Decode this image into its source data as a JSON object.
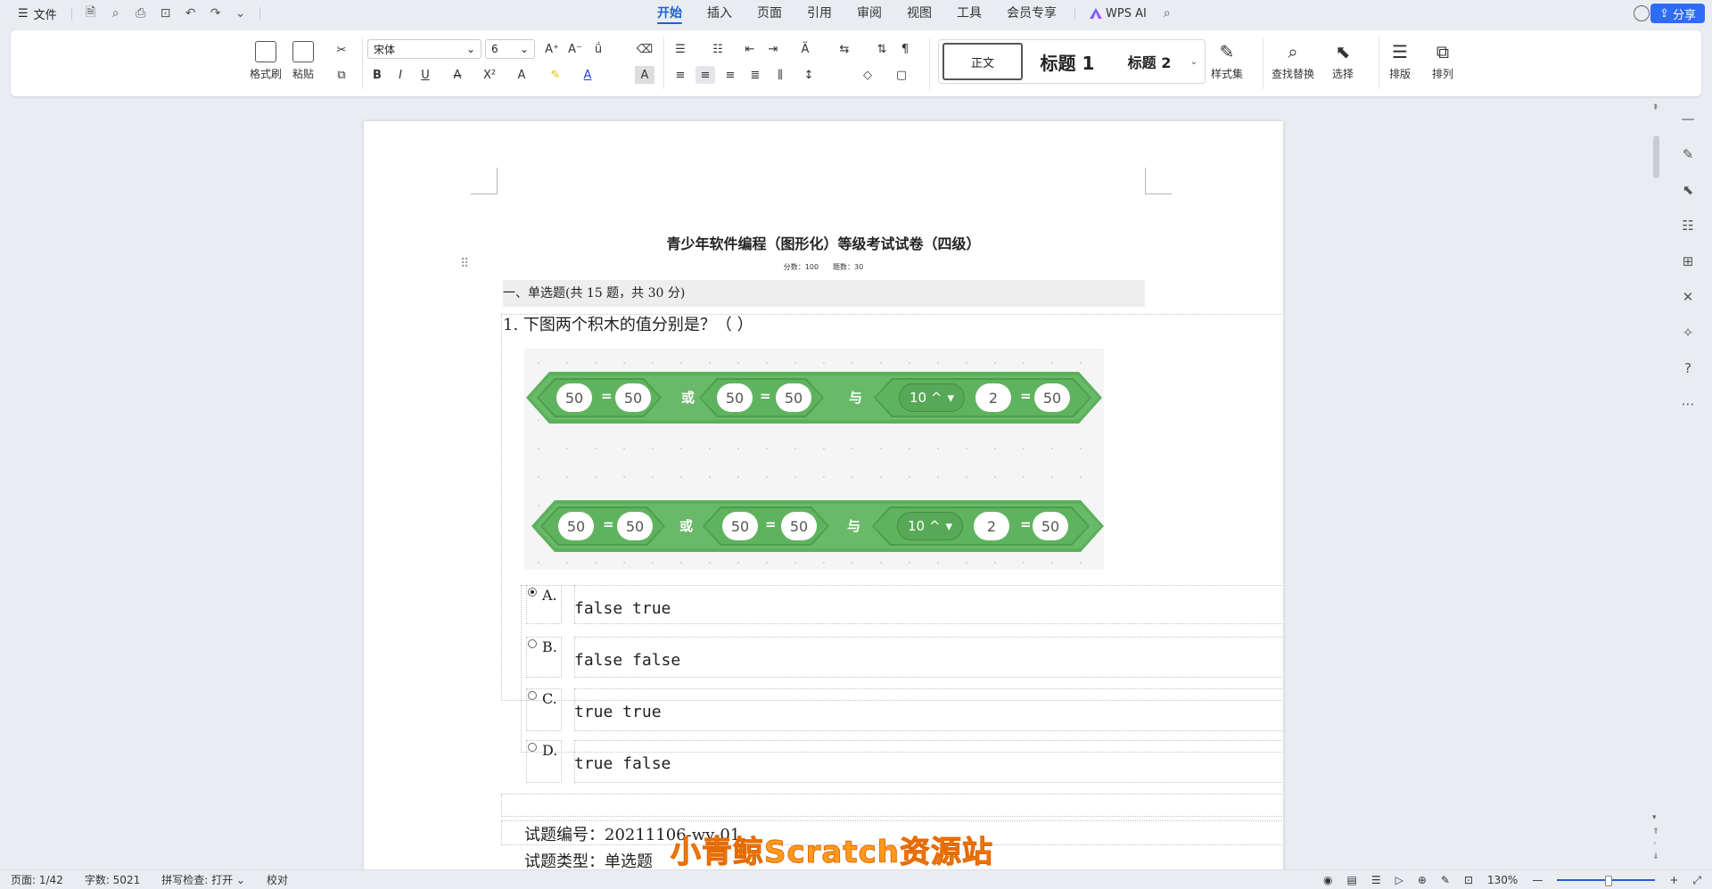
{
  "menu": {
    "file_label": "文件",
    "tabs": [
      "开始",
      "插入",
      "页面",
      "引用",
      "审阅",
      "视图",
      "工具",
      "会员专享"
    ],
    "ai_label": "WPS AI",
    "share_label": "分享"
  },
  "ribbon": {
    "format_painter": "格式刷",
    "paste": "粘贴",
    "font_name": "宋体",
    "font_size": "6",
    "styles": {
      "normal": "正文",
      "h1": "标题 1",
      "h2": "标题 2"
    },
    "style_set": "样式集",
    "find_replace": "查找替换",
    "select": "选择",
    "layout": "排版",
    "arrange": "排列"
  },
  "doc": {
    "title": "青少年软件编程（图形化）等级考试试卷（四级）",
    "meta": "分数：100　　题数：30",
    "section": "一、单选题(共 15 题，共 30 分)",
    "question": "1. 下图两个积木的值分别是？（  ）",
    "block1": {
      "a": "50",
      "b": "50",
      "or": "或",
      "c": "50",
      "d": "50",
      "and": "与",
      "pow": "10 ^",
      "e": "2",
      "f": "50",
      "eq": "="
    },
    "block2": {
      "a": "50",
      "b": "50",
      "or": "或",
      "c": "50",
      "d": "50",
      "and": "与",
      "pow": "10 ^",
      "e": "2",
      "f": "50",
      "eq": "="
    },
    "options": [
      {
        "label": "A.",
        "text": "false true",
        "selected": true
      },
      {
        "label": "B.",
        "text": "false false",
        "selected": false
      },
      {
        "label": "C.",
        "text": "true true",
        "selected": false
      },
      {
        "label": "D.",
        "text": "true false",
        "selected": false
      }
    ],
    "qid": "试题编号：20211106-wy-01",
    "qtype": "试题类型：单选题"
  },
  "watermark": "小青鲸Scratch资源站",
  "status": {
    "page": "页面: 1/42",
    "words": "字数: 5021",
    "spell": "拼写检查: 打开",
    "proof": "校对",
    "zoom": "130%"
  },
  "colors": {
    "accent": "#1f5fd6",
    "block_green": "#5cb05c",
    "watermark": "#ff9a1f"
  }
}
